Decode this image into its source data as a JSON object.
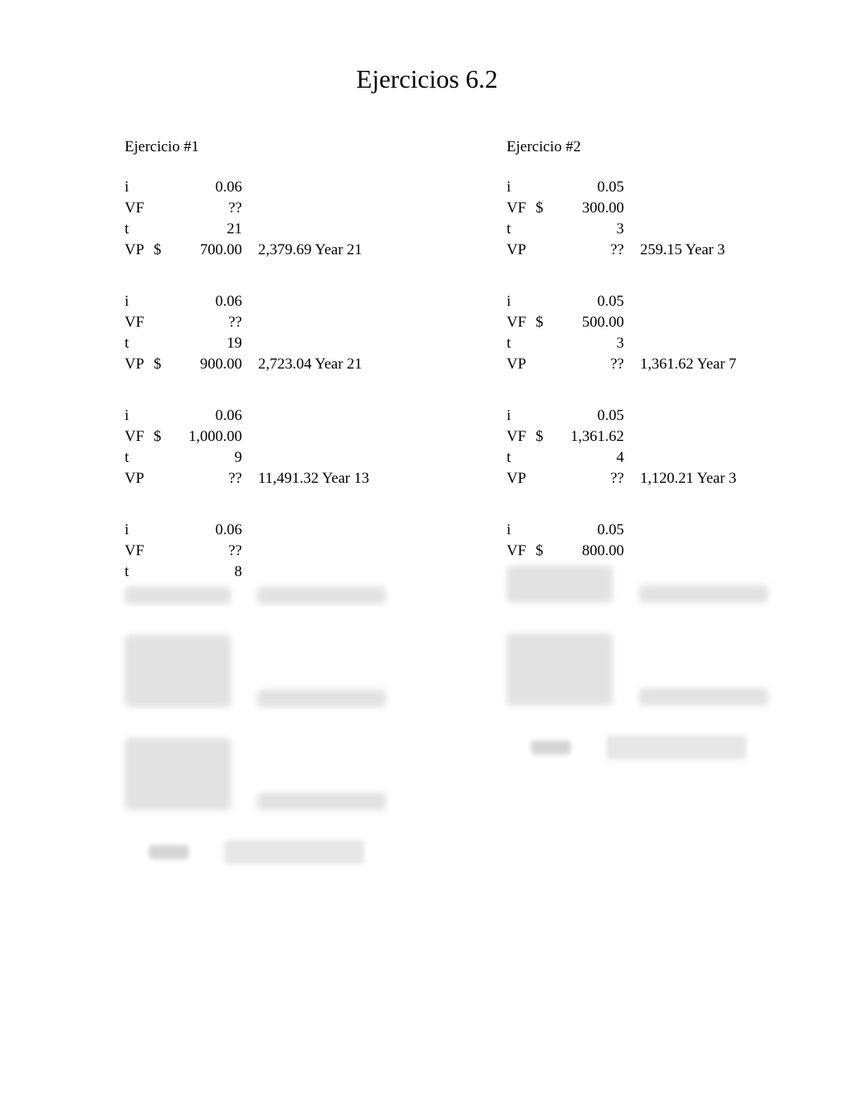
{
  "title": "Ejercicios 6.2",
  "ex1": {
    "name": "Ejercicio #1",
    "blocks": [
      {
        "rows": [
          {
            "label": "i",
            "cur": "",
            "val": "0.06"
          },
          {
            "label": "VF",
            "cur": "",
            "val": "??"
          },
          {
            "label": "t",
            "cur": "",
            "val": "21"
          },
          {
            "label": "VP",
            "cur": "$",
            "val": "700.00",
            "result": "2,379.69 Year 21"
          }
        ]
      },
      {
        "rows": [
          {
            "label": "i",
            "cur": "",
            "val": "0.06"
          },
          {
            "label": "VF",
            "cur": "",
            "val": "??"
          },
          {
            "label": "t",
            "cur": "",
            "val": "19"
          },
          {
            "label": "VP",
            "cur": "$",
            "val": "900.00",
            "result": "2,723.04 Year 21"
          }
        ]
      },
      {
        "rows": [
          {
            "label": "i",
            "cur": "",
            "val": "0.06"
          },
          {
            "label": "VF",
            "cur": "$",
            "val": "1,000.00"
          },
          {
            "label": "t",
            "cur": "",
            "val": "9"
          },
          {
            "label": "VP",
            "cur": "",
            "val": "??",
            "result": "11,491.32 Year 13"
          }
        ]
      },
      {
        "rows": [
          {
            "label": "i",
            "cur": "",
            "val": "0.06"
          },
          {
            "label": "VF",
            "cur": "",
            "val": "??"
          },
          {
            "label": "t",
            "cur": "",
            "val": "8"
          }
        ],
        "partial_blur": true
      }
    ]
  },
  "ex2": {
    "name": "Ejercicio #2",
    "blocks": [
      {
        "rows": [
          {
            "label": "i",
            "cur": "",
            "val": "0.05"
          },
          {
            "label": "VF",
            "cur": "$",
            "val": "300.00"
          },
          {
            "label": "t",
            "cur": "",
            "val": "3"
          },
          {
            "label": "VP",
            "cur": "",
            "val": "??",
            "result": "259.15 Year 3"
          }
        ]
      },
      {
        "rows": [
          {
            "label": "i",
            "cur": "",
            "val": "0.05"
          },
          {
            "label": "VF",
            "cur": "$",
            "val": "500.00"
          },
          {
            "label": "t",
            "cur": "",
            "val": "3"
          },
          {
            "label": "VP",
            "cur": "",
            "val": "??",
            "result": "1,361.62 Year 7"
          }
        ]
      },
      {
        "rows": [
          {
            "label": "i",
            "cur": "",
            "val": "0.05"
          },
          {
            "label": "VF",
            "cur": "$",
            "val": "1,361.62"
          },
          {
            "label": "t",
            "cur": "",
            "val": "4"
          },
          {
            "label": "VP",
            "cur": "",
            "val": "??",
            "result": "1,120.21 Year 3"
          }
        ]
      },
      {
        "rows": [
          {
            "label": "i",
            "cur": "",
            "val": "0.05"
          },
          {
            "label": "VF",
            "cur": "$",
            "val": "800.00"
          }
        ],
        "partial_blur": true
      }
    ]
  }
}
